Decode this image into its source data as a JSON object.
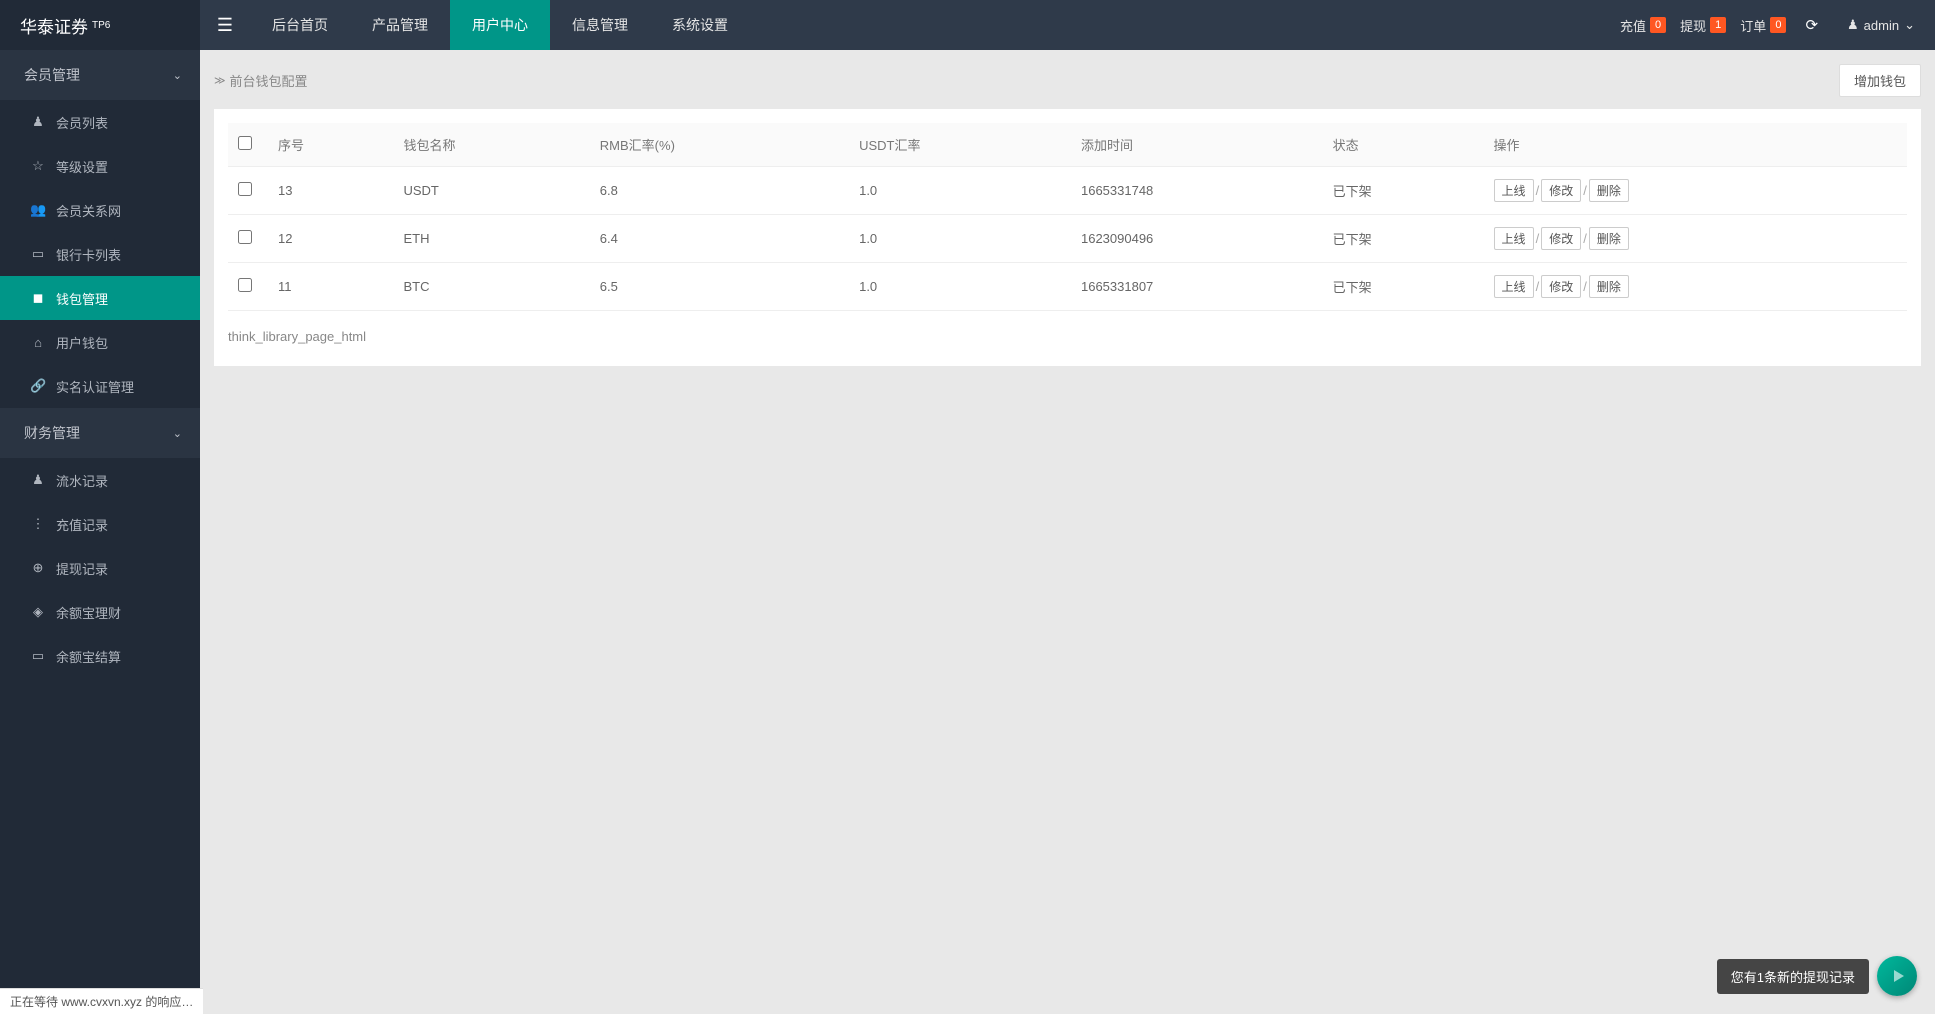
{
  "brand": {
    "name": "华泰证券",
    "sup": "TP6"
  },
  "topnav": [
    {
      "label": "后台首页",
      "active": false
    },
    {
      "label": "产品管理",
      "active": false
    },
    {
      "label": "用户中心",
      "active": true
    },
    {
      "label": "信息管理",
      "active": false
    },
    {
      "label": "系统设置",
      "active": false
    }
  ],
  "topbar_right": {
    "recharge": {
      "label": "充值",
      "count": "0"
    },
    "withdraw": {
      "label": "提现",
      "count": "1"
    },
    "order": {
      "label": "订单",
      "count": "0"
    },
    "user": {
      "name": "admin"
    }
  },
  "sidebar": {
    "groups": [
      {
        "title": "会员管理",
        "items": [
          {
            "icon": "user",
            "label": "会员列表",
            "active": false
          },
          {
            "icon": "star",
            "label": "等级设置",
            "active": false
          },
          {
            "icon": "network",
            "label": "会员关系网",
            "active": false
          },
          {
            "icon": "card",
            "label": "银行卡列表",
            "active": false
          },
          {
            "icon": "wallet",
            "label": "钱包管理",
            "active": true
          },
          {
            "icon": "userwallet",
            "label": "用户钱包",
            "active": false
          },
          {
            "icon": "link",
            "label": "实名认证管理",
            "active": false
          }
        ]
      },
      {
        "title": "财务管理",
        "items": [
          {
            "icon": "user",
            "label": "流水记录",
            "active": false
          },
          {
            "icon": "dots",
            "label": "充值记录",
            "active": false
          },
          {
            "icon": "globe",
            "label": "提现记录",
            "active": false
          },
          {
            "icon": "diamond",
            "label": "余额宝理财",
            "active": false
          },
          {
            "icon": "card",
            "label": "余额宝结算",
            "active": false
          }
        ]
      }
    ]
  },
  "breadcrumb": {
    "text": "前台钱包配置"
  },
  "buttons": {
    "add_wallet": "增加钱包"
  },
  "table": {
    "headers": [
      "序号",
      "钱包名称",
      "RMB汇率(%)",
      "USDT汇率",
      "添加时间",
      "状态",
      "操作"
    ],
    "op_labels": {
      "online": "上线",
      "edit": "修改",
      "delete": "删除",
      "sep": "/"
    },
    "rows": [
      {
        "id": "13",
        "name": "USDT",
        "rmb_rate": "6.8",
        "usdt_rate": "1.0",
        "add_time": "1665331748",
        "status": "已下架"
      },
      {
        "id": "12",
        "name": "ETH",
        "rmb_rate": "6.4",
        "usdt_rate": "1.0",
        "add_time": "1623090496",
        "status": "已下架"
      },
      {
        "id": "11",
        "name": "BTC",
        "rmb_rate": "6.5",
        "usdt_rate": "1.0",
        "add_time": "1665331807",
        "status": "已下架"
      }
    ]
  },
  "footer_note": "think_library_page_html",
  "status_bar": "正在等待 www.cvxvn.xyz 的响应…",
  "toast": {
    "message": "您有1条新的提现记录"
  },
  "icons": {
    "user": "♟",
    "star": "☆",
    "network": "👥",
    "card": "▭",
    "wallet": "◼",
    "userwallet": "⌂",
    "link": "🔗",
    "dots": "⋮",
    "globe": "⊕",
    "diamond": "◈"
  }
}
